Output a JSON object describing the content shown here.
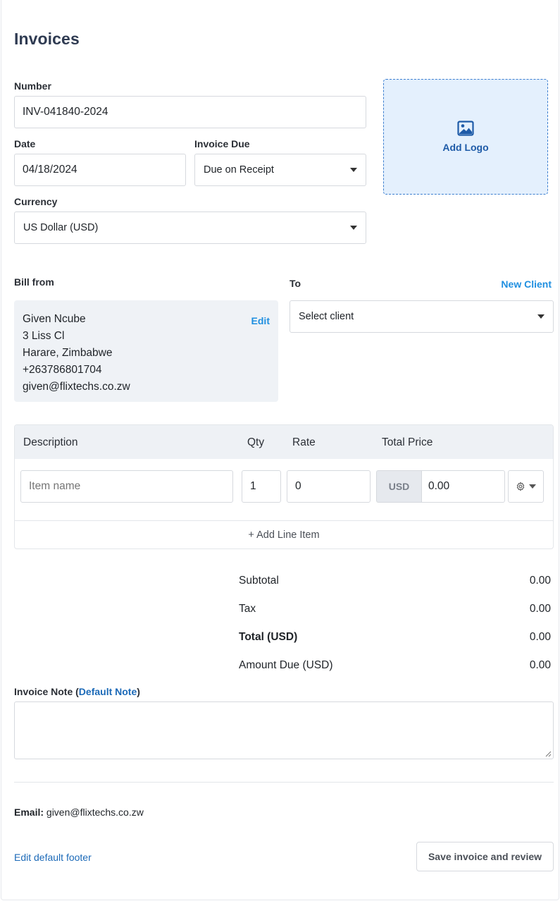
{
  "page": {
    "title": "Invoices"
  },
  "form": {
    "number_label": "Number",
    "number_value": "INV-041840-2024",
    "date_label": "Date",
    "date_value": "04/18/2024",
    "due_label": "Invoice Due",
    "due_value": "Due on Receipt",
    "currency_label": "Currency",
    "currency_value": "US Dollar (USD)"
  },
  "logo": {
    "label": "Add Logo",
    "icon": "image-icon"
  },
  "bill_from": {
    "label": "Bill from",
    "edit_label": "Edit",
    "lines": [
      "Given Ncube",
      "3 Liss Cl",
      "Harare, Zimbabwe",
      "+263786801704",
      "given@flixtechs.co.zw"
    ]
  },
  "bill_to": {
    "label": "To",
    "new_client_label": "New Client",
    "select_value": "Select client"
  },
  "items": {
    "headers": {
      "description": "Description",
      "qty": "Qty",
      "rate": "Rate",
      "total": "Total Price"
    },
    "row": {
      "name_placeholder": "Item name",
      "qty": "1",
      "rate": "0",
      "currency": "USD",
      "total": "0.00"
    },
    "add_line_label": "+ Add Line Item"
  },
  "summary": {
    "subtotal_label": "Subtotal",
    "subtotal_value": "0.00",
    "tax_label": "Tax",
    "tax_value": "0.00",
    "total_label": "Total (USD)",
    "total_value": "0.00",
    "due_label": "Amount Due (USD)",
    "due_value": "0.00"
  },
  "note": {
    "label_prefix": "Invoice Note (",
    "default_link": "Default Note",
    "label_suffix": ")"
  },
  "footer": {
    "email_label": "Email:",
    "email_value": "given@flixtechs.co.zw",
    "edit_footer_label": "Edit default footer",
    "save_label": "Save invoice and review"
  },
  "colors": {
    "accent": "#1f8fe0",
    "link": "#1c6ab8",
    "logo_bg": "#e4f0fd",
    "panel_bg": "#eff2f6"
  }
}
